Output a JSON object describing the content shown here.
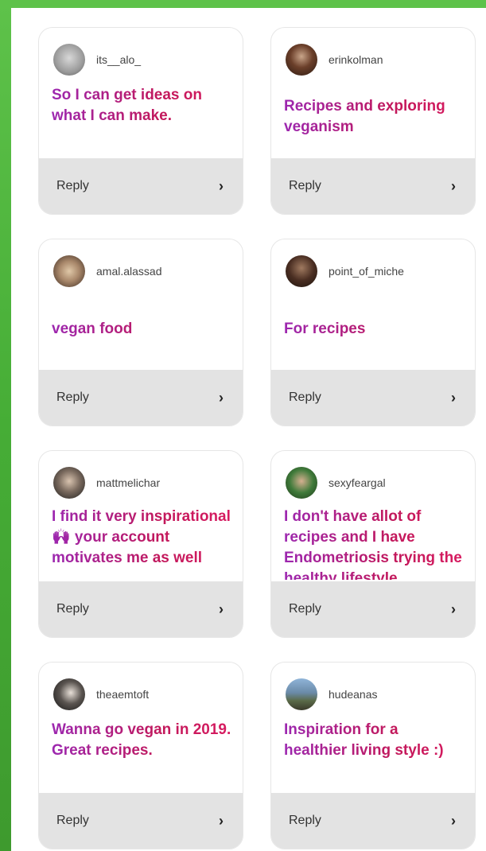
{
  "responses": [
    {
      "username": "its__alo_",
      "answer": "So I can get ideas on what I can make.",
      "reply_label": "Reply",
      "chevron": "chevron-right-icon",
      "avatar": "avatar-photo"
    },
    {
      "username": "erinkolman",
      "answer": "Recipes and exploring veganism",
      "reply_label": "Reply",
      "chevron": "chevron-right-icon",
      "avatar": "avatar-photo"
    },
    {
      "username": "amal.alassad",
      "answer": "vegan food",
      "reply_label": "Reply",
      "chevron": "chevron-right-icon",
      "avatar": "avatar-photo"
    },
    {
      "username": "point_of_miche",
      "answer": "For recipes",
      "reply_label": "Reply",
      "chevron": "chevron-right-icon",
      "avatar": "avatar-photo"
    },
    {
      "username": "mattmelichar",
      "answer": "I find it very inspirational 🙌 your account motivates me as well",
      "reply_label": "Reply",
      "chevron": "chevron-right-icon",
      "avatar": "avatar-photo"
    },
    {
      "username": "sexyfeargal",
      "answer": "I don't have allot of recipes and I have Endometriosis trying the healthy lifestyle",
      "reply_label": "Reply",
      "chevron": "chevron-right-icon",
      "avatar": "avatar-photo"
    },
    {
      "username": "theaemtoft",
      "answer": "Wanna go vegan in 2019. Great recipes.",
      "reply_label": "Reply",
      "chevron": "chevron-right-icon",
      "avatar": "avatar-photo"
    },
    {
      "username": "hudeanas",
      "answer": "Inspiration for a healthier living style :)",
      "reply_label": "Reply",
      "chevron": "chevron-right-icon",
      "avatar": "avatar-photo"
    }
  ],
  "colors": {
    "frame": "#46ad36",
    "answer_start": "#9c27b0",
    "answer_end": "#d81b60",
    "reply_bar": "#e3e3e3"
  }
}
